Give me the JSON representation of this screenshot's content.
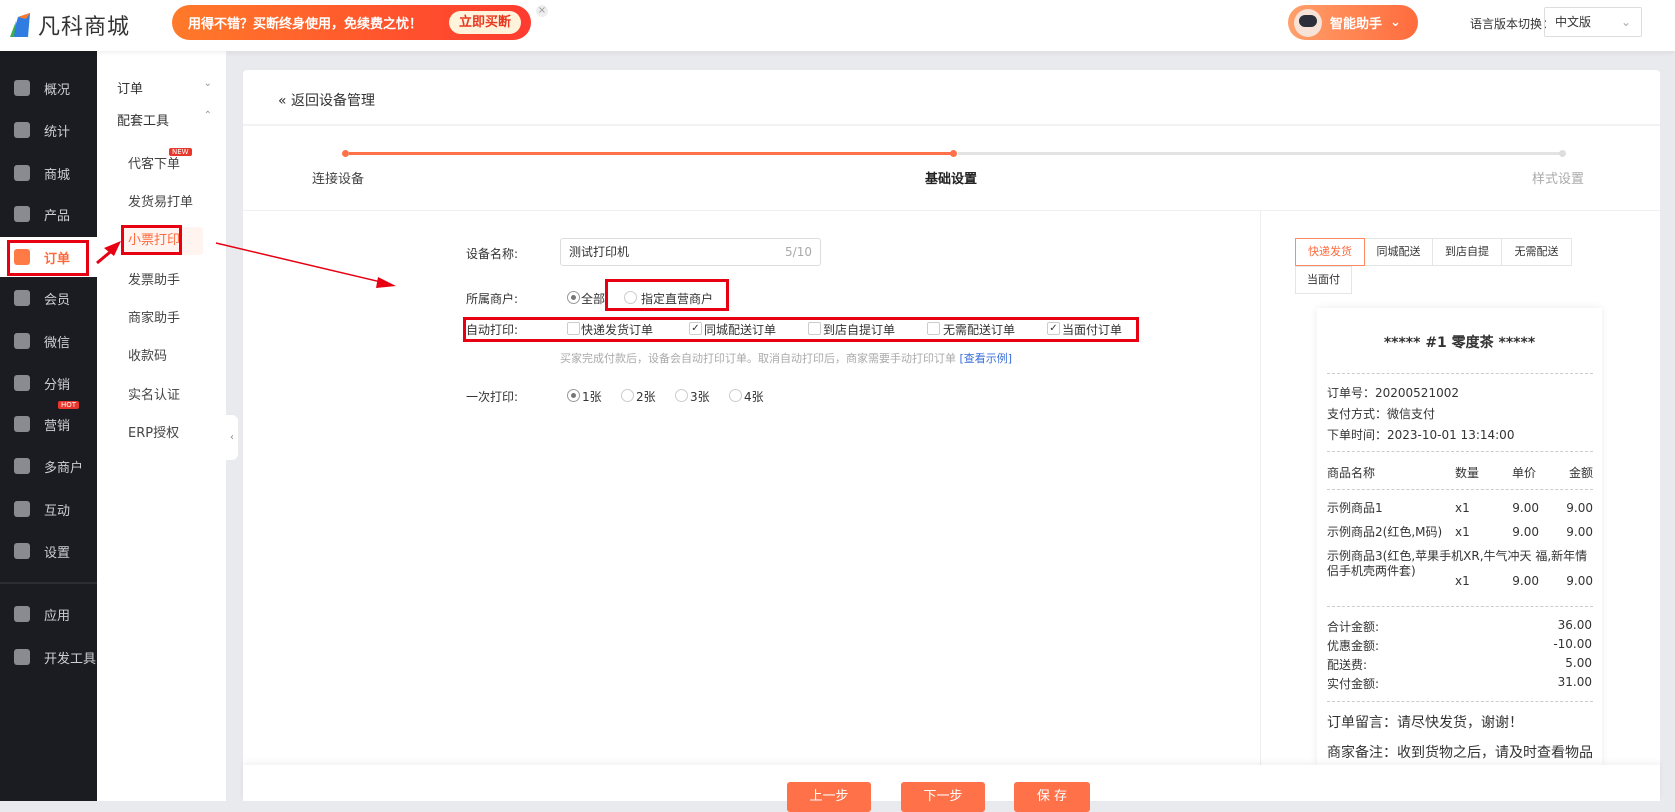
{
  "header": {
    "brand": "凡科商城",
    "banner_text": "用得不错？买断终身使用，免续费之忧！",
    "banner_button": "立即买断",
    "assistant": "智能助手",
    "lang_label": "语言版本切换：",
    "lang_value": "中文版"
  },
  "sidebar": {
    "items": [
      {
        "label": "概况",
        "icon": "layers-icon"
      },
      {
        "label": "统计",
        "icon": "chart-icon"
      },
      {
        "label": "商城",
        "icon": "shop-icon"
      },
      {
        "label": "产品",
        "icon": "grid-icon"
      },
      {
        "label": "订单",
        "icon": "clipboard-icon"
      },
      {
        "label": "会员",
        "icon": "crown-icon"
      },
      {
        "label": "微信",
        "icon": "wechat-icon"
      },
      {
        "label": "分销",
        "icon": "users-icon"
      },
      {
        "label": "营销",
        "icon": "flag-icon",
        "badge": "HOT"
      },
      {
        "label": "多商户",
        "icon": "store-icon"
      },
      {
        "label": "互动",
        "icon": "interact-icon"
      },
      {
        "label": "设置",
        "icon": "gear-icon"
      },
      {
        "label": "应用",
        "icon": "apps-icon"
      },
      {
        "label": "开发工具",
        "icon": "tools-icon"
      }
    ]
  },
  "subnav": {
    "group1": "订单",
    "group2": "配套工具",
    "items": [
      {
        "label": "代客下单",
        "badge": "NEW"
      },
      {
        "label": "发货易打单"
      },
      {
        "label": "小票打印"
      },
      {
        "label": "发票助手"
      },
      {
        "label": "商家助手"
      },
      {
        "label": "收款码"
      },
      {
        "label": "实名认证"
      },
      {
        "label": "ERP授权"
      }
    ]
  },
  "page": {
    "back": "返回设备管理",
    "steps": [
      "连接设备",
      "基础设置",
      "样式设置"
    ],
    "current_step": 2
  },
  "form": {
    "name_label": "设备名称:",
    "name_value": "测试打印机",
    "name_count": "5/10",
    "merchant_label": "所属商户:",
    "merchant_options": [
      "全部",
      "指定直营商户"
    ],
    "merchant_selected": "全部",
    "auto_label": "自动打印:",
    "auto_options": [
      {
        "label": "快递发货订单",
        "checked": false
      },
      {
        "label": "同城配送订单",
        "checked": true
      },
      {
        "label": "到店自提订单",
        "checked": false
      },
      {
        "label": "无需配送订单",
        "checked": false
      },
      {
        "label": "当面付订单",
        "checked": true
      }
    ],
    "helper": "买家完成付款后，设备会自动打印订单。取消自动打印后，商家需要手动打印订单",
    "helper_link": "[查看示例]",
    "copies_label": "一次打印:",
    "copies_options": [
      "1张",
      "2张",
      "3张",
      "4张"
    ],
    "copies_selected": "1张"
  },
  "preview": {
    "tabs": [
      "快递发货",
      "同城配送",
      "到店自提",
      "无需配送",
      "当面付"
    ],
    "active_tab": "快递发货",
    "receipt": {
      "title": "***** #1  零度茶 *****",
      "order_no": "订单号：20200521002",
      "pay": "支付方式：微信支付",
      "time": "下单时间：2023-10-01 13:14:00",
      "cols": [
        "商品名称",
        "数量",
        "单价",
        "金额"
      ],
      "items": [
        {
          "name": "示例商品1",
          "qty": "x1",
          "price": "9.00",
          "amount": "9.00"
        },
        {
          "name": "示例商品2(红色,M码)",
          "qty": "x1",
          "price": "9.00",
          "amount": "9.00"
        },
        {
          "name": "示例商品3(红色,苹果手机XR,牛气冲天 福,新年情侣手机壳两件套)",
          "qty": "x1",
          "price": "9.00",
          "amount": "9.00"
        }
      ],
      "totals": [
        {
          "label": "合计金额:",
          "value": "36.00"
        },
        {
          "label": "优惠金额:",
          "value": "-10.00"
        },
        {
          "label": "配送费:",
          "value": "5.00"
        },
        {
          "label": "实付金额:",
          "value": "31.00"
        }
      ],
      "message": "订单留言：请尽快发货，谢谢！",
      "remark": "商家备注：收到货物之后，请及时查看物品"
    }
  },
  "footer": {
    "prev": "上一步",
    "next": "下一步",
    "save": "保 存"
  },
  "colors": {
    "accent": "#ff7249",
    "sidebar": "#1b1c21",
    "highlight": "#e60012"
  }
}
